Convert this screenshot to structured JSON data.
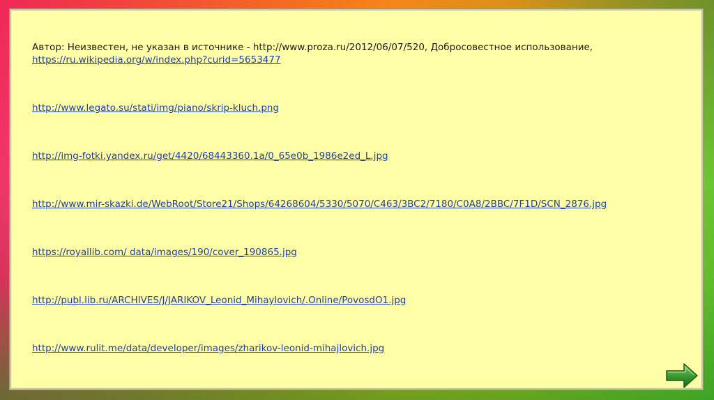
{
  "author_line": "Автор: Неизвестен, не указан в источнике - http://www.proza.ru/2012/06/07/520, Добросовестное использование,",
  "links": [
    "https://ru.wikipedia.org/w/index.php?curid=5653477",
    "http://www.legato.su/stati/img/piano/skrip-kluch.png",
    "http://img-fotki.yandex.ru/get/4420/68443360.1a/0_65e0b_1986e2ed_L.jpg",
    "http://www.mir-skazki.de/WebRoot/Store21/Shops/64268604/5330/5070/C463/3BC2/7180/C0A8/2BBC/7F1D/SCN_2876.jpg",
    "https://royallib.com/ data/images/190/cover_190865.jpg",
    "http://publ.lib.ru/ARCHIVES/J/JARIKOV_Leonid_Mihaylovich/.Online/PovosdO1.jpg",
    "http://www.rulit.me/data/developer/images/zharikov-leonid-mihajlovich.jpg"
  ],
  "colors": {
    "panel": "#ffffa8",
    "link": "#1f3fa6",
    "arrow": "#3c9a2e"
  },
  "icons": {
    "next": "arrow-right-icon"
  }
}
